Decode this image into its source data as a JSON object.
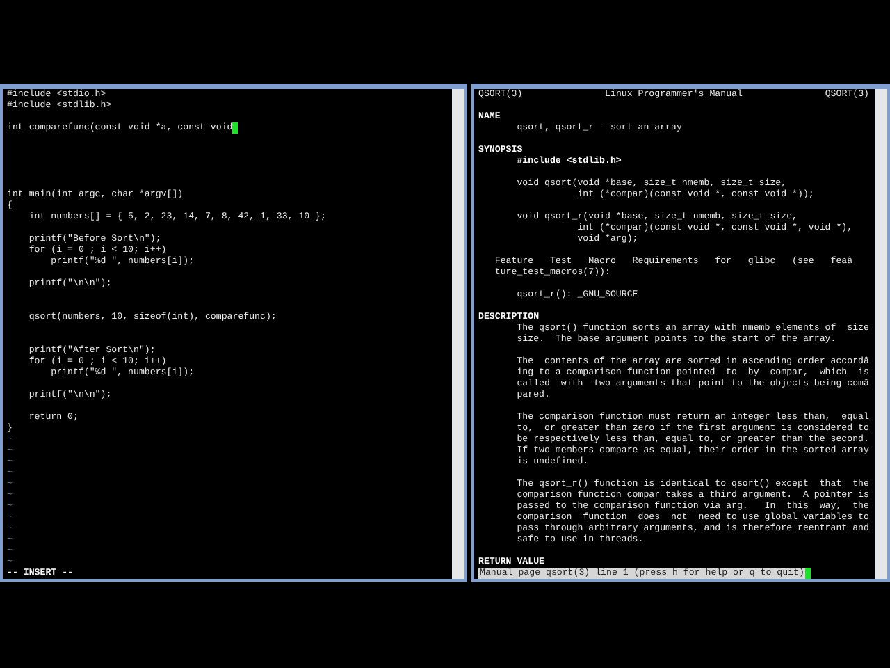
{
  "editor": {
    "lines": [
      {
        "kind": "code",
        "text": "#include <stdio.h>",
        "cursor": false
      },
      {
        "kind": "code",
        "text": "#include <stdlib.h>",
        "cursor": false
      },
      {
        "kind": "blank"
      },
      {
        "kind": "code",
        "text": "int comparefunc(const void *a, const void",
        "cursor": true
      },
      {
        "kind": "blank"
      },
      {
        "kind": "blank"
      },
      {
        "kind": "blank"
      },
      {
        "kind": "blank"
      },
      {
        "kind": "blank"
      },
      {
        "kind": "code",
        "text": "int main(int argc, char *argv[])",
        "cursor": false
      },
      {
        "kind": "code",
        "text": "{",
        "cursor": false
      },
      {
        "kind": "code",
        "text": "    int numbers[] = { 5, 2, 23, 14, 7, 8, 42, 1, 33, 10 };",
        "cursor": false
      },
      {
        "kind": "blank"
      },
      {
        "kind": "code",
        "text": "    printf(\"Before Sort\\n\");",
        "cursor": false
      },
      {
        "kind": "code",
        "text": "    for (i = 0 ; i < 10; i++)",
        "cursor": false
      },
      {
        "kind": "code",
        "text": "        printf(\"%d \", numbers[i]);",
        "cursor": false
      },
      {
        "kind": "blank"
      },
      {
        "kind": "code",
        "text": "    printf(\"\\n\\n\");",
        "cursor": false
      },
      {
        "kind": "blank"
      },
      {
        "kind": "blank"
      },
      {
        "kind": "code",
        "text": "    qsort(numbers, 10, sizeof(int), comparefunc);",
        "cursor": false
      },
      {
        "kind": "blank"
      },
      {
        "kind": "blank"
      },
      {
        "kind": "code",
        "text": "    printf(\"After Sort\\n\");",
        "cursor": false
      },
      {
        "kind": "code",
        "text": "    for (i = 0 ; i < 10; i++)",
        "cursor": false
      },
      {
        "kind": "code",
        "text": "        printf(\"%d \", numbers[i]);",
        "cursor": false
      },
      {
        "kind": "blank"
      },
      {
        "kind": "code",
        "text": "    printf(\"\\n\\n\");",
        "cursor": false
      },
      {
        "kind": "blank"
      },
      {
        "kind": "code",
        "text": "    return 0;",
        "cursor": false
      },
      {
        "kind": "code",
        "text": "}",
        "cursor": false
      },
      {
        "kind": "filler",
        "text": "~"
      },
      {
        "kind": "filler",
        "text": "~"
      },
      {
        "kind": "filler",
        "text": "~"
      },
      {
        "kind": "filler",
        "text": "~"
      },
      {
        "kind": "filler",
        "text": "~"
      },
      {
        "kind": "filler",
        "text": "~"
      },
      {
        "kind": "filler",
        "text": "~"
      },
      {
        "kind": "filler",
        "text": "~"
      },
      {
        "kind": "filler",
        "text": "~"
      },
      {
        "kind": "filler",
        "text": "~"
      },
      {
        "kind": "filler",
        "text": "~"
      },
      {
        "kind": "filler",
        "text": "~"
      }
    ],
    "mode": "-- INSERT --"
  },
  "manual": {
    "header": {
      "left": "QSORT(3)",
      "center": "Linux Programmer's Manual",
      "right": "QSORT(3)"
    },
    "lines": [
      {
        "kind": "blank"
      },
      {
        "kind": "heading",
        "text": "NAME"
      },
      {
        "kind": "text",
        "text": "       qsort, qsort_r - sort an array"
      },
      {
        "kind": "blank"
      },
      {
        "kind": "heading",
        "text": "SYNOPSIS"
      },
      {
        "kind": "bold",
        "text": "       #include <stdlib.h>"
      },
      {
        "kind": "blank"
      },
      {
        "kind": "text",
        "text": "       void qsort(void *base, size_t nmemb, size_t size,"
      },
      {
        "kind": "text",
        "text": "                  int (*compar)(const void *, const void *));"
      },
      {
        "kind": "blank"
      },
      {
        "kind": "text",
        "text": "       void qsort_r(void *base, size_t nmemb, size_t size,"
      },
      {
        "kind": "text",
        "text": "                  int (*compar)(const void *, const void *, void *),"
      },
      {
        "kind": "text",
        "text": "                  void *arg);"
      },
      {
        "kind": "blank"
      },
      {
        "kind": "text",
        "text": "   Feature   Test   Macro   Requirements   for   glibc   (see   feaâ"
      },
      {
        "kind": "text",
        "text": "   ture_test_macros(7)):"
      },
      {
        "kind": "blank"
      },
      {
        "kind": "text",
        "text": "       qsort_r(): _GNU_SOURCE"
      },
      {
        "kind": "blank"
      },
      {
        "kind": "heading",
        "text": "DESCRIPTION"
      },
      {
        "kind": "text",
        "text": "       The qsort() function sorts an array with nmemb elements of  size"
      },
      {
        "kind": "text",
        "text": "       size.  The base argument points to the start of the array."
      },
      {
        "kind": "blank"
      },
      {
        "kind": "text",
        "text": "       The  contents of the array are sorted in ascending order accordâ"
      },
      {
        "kind": "text",
        "text": "       ing to a comparison function pointed  to  by  compar,  which  is"
      },
      {
        "kind": "text",
        "text": "       called  with  two arguments that point to the objects being comâ"
      },
      {
        "kind": "text",
        "text": "       pared."
      },
      {
        "kind": "blank"
      },
      {
        "kind": "text",
        "text": "       The comparison function must return an integer less than,  equal"
      },
      {
        "kind": "text",
        "text": "       to,  or greater than zero if the first argument is considered to"
      },
      {
        "kind": "text",
        "text": "       be respectively less than, equal to, or greater than the second."
      },
      {
        "kind": "text",
        "text": "       If two members compare as equal, their order in the sorted array"
      },
      {
        "kind": "text",
        "text": "       is undefined."
      },
      {
        "kind": "blank"
      },
      {
        "kind": "text",
        "text": "       The qsort_r() function is identical to qsort() except  that  the"
      },
      {
        "kind": "text",
        "text": "       comparison function compar takes a third argument.  A pointer is"
      },
      {
        "kind": "text",
        "text": "       passed to the comparison function via arg.   In  this  way,  the"
      },
      {
        "kind": "text",
        "text": "       comparison  function  does  not  need to use global variables to"
      },
      {
        "kind": "text",
        "text": "       pass through arbitrary arguments, and is therefore reentrant and"
      },
      {
        "kind": "text",
        "text": "       safe to use in threads."
      },
      {
        "kind": "blank"
      },
      {
        "kind": "heading",
        "text": "RETURN VALUE"
      }
    ],
    "status": "Manual page qsort(3) line 1 (press h for help or q to quit)"
  }
}
